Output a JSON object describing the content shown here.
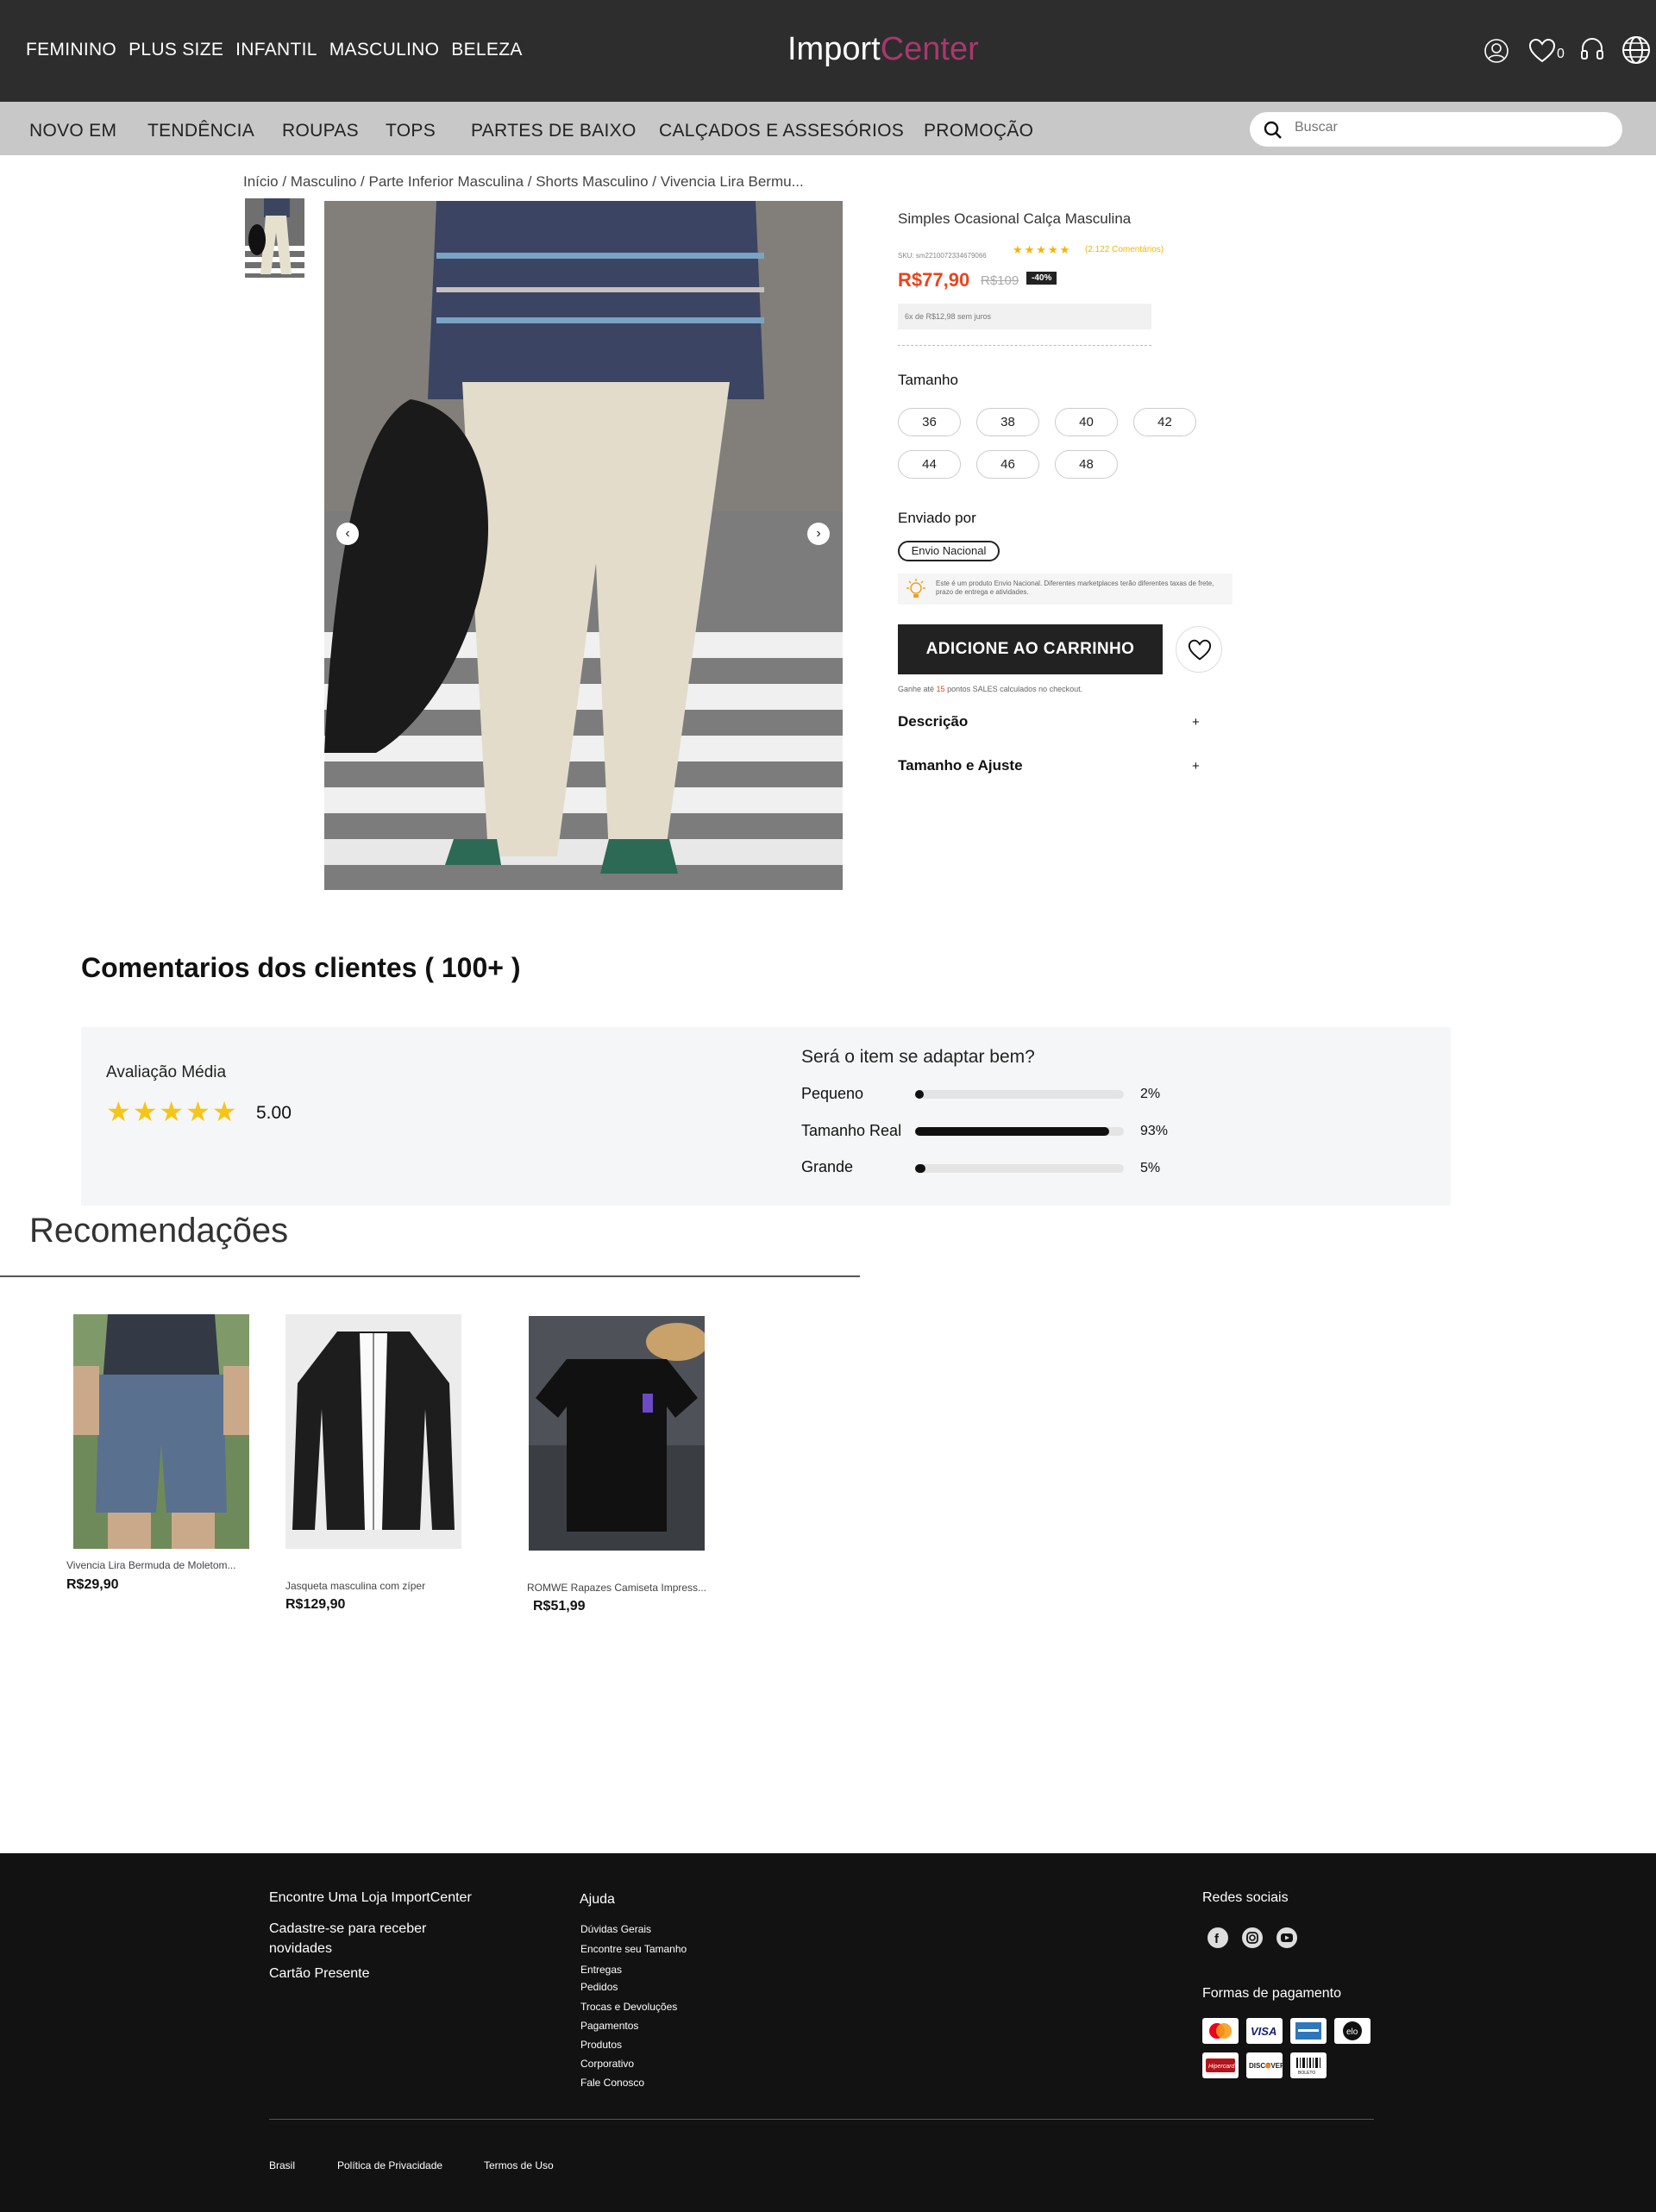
{
  "header": {
    "top_categories": [
      "FEMININO",
      "PLUS SIZE",
      "INFANTIL",
      "MASCULINO",
      "BELEZA"
    ],
    "logo_main": "Import",
    "logo_accent": "Center",
    "wishlist_count": "0",
    "icons": [
      "user-icon",
      "heart-icon",
      "headset-icon",
      "globe-icon"
    ]
  },
  "nav": {
    "items": [
      "NOVO EM",
      "TENDÊNCIA",
      "ROUPAS",
      "TOPS",
      "PARTES DE BAIXO",
      "CALÇADOS E ASSESÓRIOS",
      "PROMOÇÃO"
    ],
    "search_placeholder": "Buscar"
  },
  "breadcrumb": "Início / Masculino / Parte Inferior Masculina / Shorts Masculino / Vivencia Lira Bermu...",
  "product": {
    "title": "Simples Ocasional Calça Masculina",
    "sku": "SKU: sm2210072334679066",
    "rating_stars": 5,
    "review_count": "(2.122 Comentários)",
    "price": "R$77,90",
    "old_price": "R$109",
    "discount": "-40%",
    "installments": "6x de R$12,98 sem juros",
    "size_label": "Tamanho",
    "sizes": [
      "36",
      "38",
      "40",
      "42",
      "44",
      "46",
      "48"
    ],
    "shipped_label": "Enviado por",
    "ship_option": "Envio Nacional",
    "notice_text": "Este é um produto Envio Nacional. Diferentes marketplaces terão diferentes taxas de frete, prazo de entrega e atividades.",
    "cart_button": "ADICIONE AO CARRINHO",
    "points_pre": "Ganhe até ",
    "points_value": "15",
    "points_post": " pontos SALES calculados no checkout.",
    "accordion": [
      "Descrição",
      "Tamanho e Ajuste"
    ],
    "accordion_symbol": "+"
  },
  "reviews": {
    "title": "Comentarios dos clientes ( 100+ )",
    "avg_label": "Avaliação Média",
    "avg_score": "5.00",
    "fit_question": "Será o item se adaptar bem?",
    "fit": [
      {
        "label": "Pequeno",
        "percent": 2,
        "text": "2%"
      },
      {
        "label": "Tamanho Real",
        "percent": 93,
        "text": "93%"
      },
      {
        "label": "Grande",
        "percent": 5,
        "text": "5%"
      }
    ]
  },
  "recommendations": {
    "title": "Recomendações",
    "items": [
      {
        "name": "Vivencia Lira Bermuda de Moletom...",
        "price": "R$29,90"
      },
      {
        "name": "Jasqueta masculina com zíper",
        "price": "R$129,90"
      },
      {
        "name": "ROMWE Rapazes Camiseta Impress...",
        "price": "R$51,99"
      }
    ]
  },
  "footer": {
    "col1": [
      "Encontre Uma Loja ImportCenter",
      "Cadastre-se para receber novidades",
      "Cartão Presente"
    ],
    "help_title": "Ajuda",
    "help_links": [
      "Dúvidas Gerais",
      "Encontre seu Tamanho",
      "Entregas",
      "Pedidos",
      "Trocas e Devoluções",
      "Pagamentos",
      "Produtos",
      "Corporativo",
      "Fale Conosco"
    ],
    "social_title": "Redes sociais",
    "payment_title": "Formas de pagamento",
    "payments": [
      "mastercard",
      "VISA",
      "AMEX",
      "elo",
      "Hipercard",
      "DISCOVER",
      "BOLETO"
    ],
    "bottom_links": [
      "Brasil",
      "Política de Privacidade",
      "Termos de Uso"
    ]
  }
}
